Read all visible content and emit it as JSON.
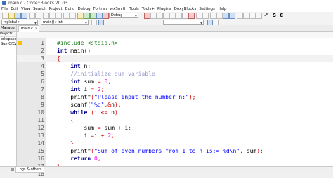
{
  "window": {
    "title": "main.c - Code::Blocks 20.03"
  },
  "menu": [
    "File",
    "Edit",
    "View",
    "Search",
    "Project",
    "Build",
    "Debug",
    "Fortran",
    "wxSmith",
    "Tools",
    "Tools+",
    "Plugins",
    "DoxyBlocks",
    "Settings",
    "Help"
  ],
  "toolbar": {
    "build_target": "Debug",
    "scope": "<global>",
    "function": "main() : int",
    "regex_glyph": ".*",
    "search_glyph": "S",
    "comment_glyph": "C"
  },
  "left_panel": {
    "title": "Management",
    "tabs": "Projects",
    "items": [
      "orkspace",
      "SumOfEv"
    ]
  },
  "editor": {
    "tab_label": "main.c",
    "lines": [
      {
        "n": "1",
        "tokens": [
          {
            "t": "#include <stdio.h>",
            "c": "tk-pp"
          }
        ]
      },
      {
        "n": "2",
        "tokens": [
          {
            "t": "int",
            "c": "tk-kw"
          },
          {
            "t": " main"
          },
          {
            "t": "()",
            "c": "tk-op"
          }
        ]
      },
      {
        "n": "3",
        "tokens": [
          {
            "t": "{",
            "c": "tk-op"
          }
        ]
      },
      {
        "n": "4",
        "tokens": [
          {
            "t": "    "
          },
          {
            "t": "int",
            "c": "tk-kw"
          },
          {
            "t": " n"
          },
          {
            "t": ";",
            "c": "tk-op"
          }
        ]
      },
      {
        "n": "5",
        "tokens": [
          {
            "t": "    "
          },
          {
            "t": "//initialize sum variable",
            "c": "tk-cm"
          }
        ]
      },
      {
        "n": "6",
        "tokens": [
          {
            "t": "    "
          },
          {
            "t": "int",
            "c": "tk-kw"
          },
          {
            "t": " sum "
          },
          {
            "t": "=",
            "c": "tk-op"
          },
          {
            "t": " "
          },
          {
            "t": "0",
            "c": "tk-num"
          },
          {
            "t": ";",
            "c": "tk-op"
          }
        ]
      },
      {
        "n": "7",
        "tokens": [
          {
            "t": "    "
          },
          {
            "t": "int",
            "c": "tk-kw"
          },
          {
            "t": " i "
          },
          {
            "t": "=",
            "c": "tk-op"
          },
          {
            "t": " "
          },
          {
            "t": "2",
            "c": "tk-num"
          },
          {
            "t": ";",
            "c": "tk-op"
          }
        ]
      },
      {
        "n": "8",
        "tokens": [
          {
            "t": "    printf"
          },
          {
            "t": "(",
            "c": "tk-op"
          },
          {
            "t": "\"Please input the number n:\"",
            "c": "tk-str"
          },
          {
            "t": ");",
            "c": "tk-op"
          }
        ]
      },
      {
        "n": "9",
        "tokens": [
          {
            "t": "    scanf"
          },
          {
            "t": "(",
            "c": "tk-op"
          },
          {
            "t": "\"%d\"",
            "c": "tk-str"
          },
          {
            "t": ",&",
            "c": "tk-op"
          },
          {
            "t": "n"
          },
          {
            "t": ");",
            "c": "tk-op"
          }
        ]
      },
      {
        "n": "10",
        "tokens": [
          {
            "t": "    "
          },
          {
            "t": "while",
            "c": "tk-kw"
          },
          {
            "t": " "
          },
          {
            "t": "(",
            "c": "tk-op"
          },
          {
            "t": "i "
          },
          {
            "t": "<=",
            "c": "tk-op"
          },
          {
            "t": " n"
          },
          {
            "t": ")",
            "c": "tk-op"
          }
        ]
      },
      {
        "n": "11",
        "tokens": [
          {
            "t": "    "
          },
          {
            "t": "{",
            "c": "tk-op"
          }
        ]
      },
      {
        "n": "12",
        "tokens": [
          {
            "t": "        sum "
          },
          {
            "t": "=",
            "c": "tk-op"
          },
          {
            "t": " sum "
          },
          {
            "t": "+",
            "c": "tk-op"
          },
          {
            "t": " i"
          },
          {
            "t": ";",
            "c": "tk-op"
          }
        ]
      },
      {
        "n": "13",
        "tokens": [
          {
            "t": "        i "
          },
          {
            "t": "=",
            "c": "tk-op"
          },
          {
            "t": "i "
          },
          {
            "t": "+",
            "c": "tk-op"
          },
          {
            "t": " "
          },
          {
            "t": "2",
            "c": "tk-num"
          },
          {
            "t": ";",
            "c": "tk-op"
          }
        ]
      },
      {
        "n": "14",
        "tokens": [
          {
            "t": "    "
          },
          {
            "t": "}",
            "c": "tk-op"
          }
        ]
      },
      {
        "n": "15",
        "tokens": [
          {
            "t": "    printf"
          },
          {
            "t": "(",
            "c": "tk-op"
          },
          {
            "t": "\"Sum of even numbers from 1 to n is:= %d\\n\"",
            "c": "tk-str"
          },
          {
            "t": ",",
            "c": "tk-op"
          },
          {
            "t": " sum"
          },
          {
            "t": ");",
            "c": "tk-op"
          }
        ]
      },
      {
        "n": "16",
        "tokens": [
          {
            "t": "    "
          },
          {
            "t": "return",
            "c": "tk-kw"
          },
          {
            "t": " "
          },
          {
            "t": "0",
            "c": "tk-num"
          },
          {
            "t": ";",
            "c": "tk-op"
          }
        ]
      },
      {
        "n": "17",
        "tokens": [
          {
            "t": "}",
            "c": "tk-op"
          }
        ]
      },
      {
        "n": "18",
        "tokens": []
      }
    ]
  },
  "bottom_panel": {
    "tab_label": "Logs & others"
  }
}
